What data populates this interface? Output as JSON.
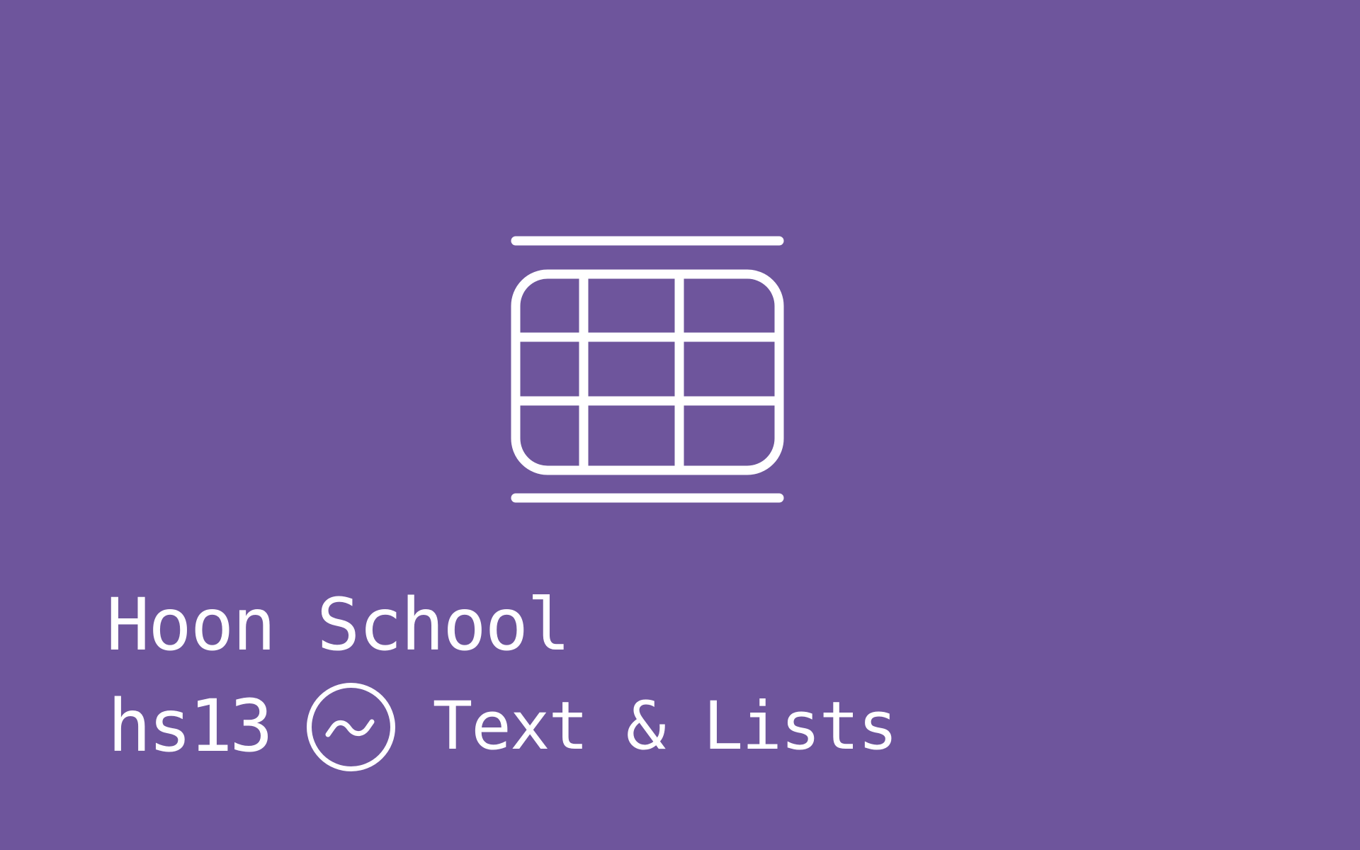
{
  "brand": {
    "background": "#6e559c",
    "foreground": "#ffffff"
  },
  "icons": {
    "hero": "table-grid-icon",
    "separator": "tilde-circle-icon"
  },
  "course": {
    "title": "Hoon School"
  },
  "lesson": {
    "code": "hs13",
    "title": "Text & Lists"
  }
}
